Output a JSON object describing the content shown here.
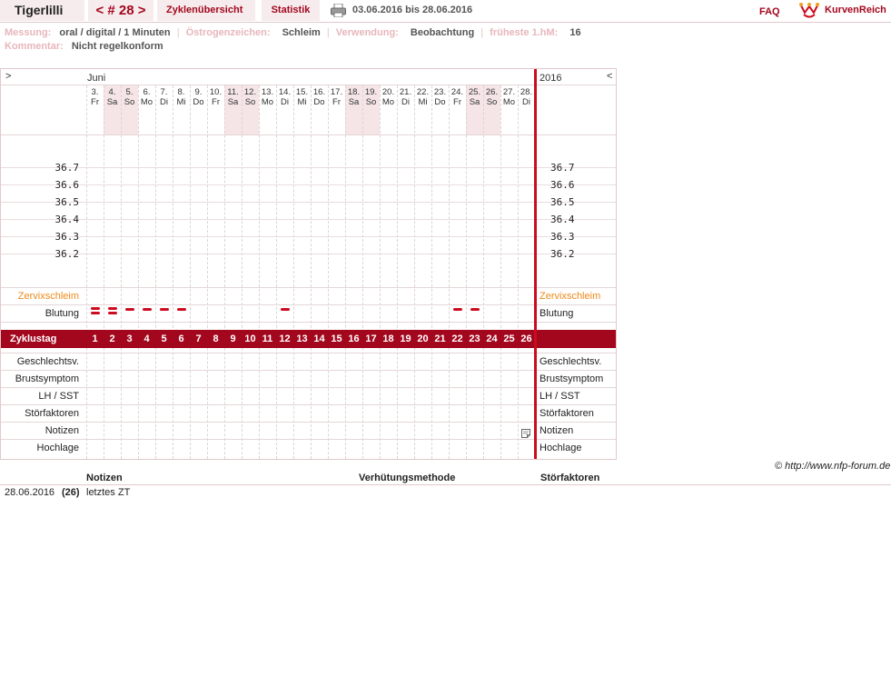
{
  "header": {
    "user_name": "Tigerlilli",
    "cycle_label": "< # 28 >",
    "tab_overview": "Zyklenübersicht",
    "tab_statistics": "Statistik",
    "date_range": "03.06.2016 bis 28.06.2016",
    "faq": "FAQ",
    "logo_text": "KurvenReich"
  },
  "info": {
    "row1": [
      {
        "label": "Messung:",
        "value": "oral / digital / 1 Minuten"
      },
      {
        "label": "Östrogenzeichen:",
        "value": "Schleim"
      },
      {
        "label": "Verwendung:",
        "value": "Beobachtung"
      },
      {
        "label": "früheste 1.hM:",
        "value": "16"
      }
    ],
    "row2": [
      {
        "label": "Kommentar:",
        "value": "Nicht regelkonform"
      }
    ]
  },
  "chart": {
    "nav_prev": ">",
    "nav_next": "<",
    "month": "Juni",
    "year": "2016",
    "days": [
      {
        "d": "3.",
        "w": "Fr",
        "weekend": false
      },
      {
        "d": "4.",
        "w": "Sa",
        "weekend": true
      },
      {
        "d": "5.",
        "w": "So",
        "weekend": true
      },
      {
        "d": "6.",
        "w": "Mo",
        "weekend": false
      },
      {
        "d": "7.",
        "w": "Di",
        "weekend": false
      },
      {
        "d": "8.",
        "w": "Mi",
        "weekend": false
      },
      {
        "d": "9.",
        "w": "Do",
        "weekend": false
      },
      {
        "d": "10.",
        "w": "Fr",
        "weekend": false
      },
      {
        "d": "11.",
        "w": "Sa",
        "weekend": true
      },
      {
        "d": "12.",
        "w": "So",
        "weekend": true
      },
      {
        "d": "13.",
        "w": "Mo",
        "weekend": false
      },
      {
        "d": "14.",
        "w": "Di",
        "weekend": false
      },
      {
        "d": "15.",
        "w": "Mi",
        "weekend": false
      },
      {
        "d": "16.",
        "w": "Do",
        "weekend": false
      },
      {
        "d": "17.",
        "w": "Fr",
        "weekend": false
      },
      {
        "d": "18.",
        "w": "Sa",
        "weekend": true
      },
      {
        "d": "19.",
        "w": "So",
        "weekend": true
      },
      {
        "d": "20.",
        "w": "Mo",
        "weekend": false
      },
      {
        "d": "21.",
        "w": "Di",
        "weekend": false
      },
      {
        "d": "22.",
        "w": "Mi",
        "weekend": false
      },
      {
        "d": "23.",
        "w": "Do",
        "weekend": false
      },
      {
        "d": "24.",
        "w": "Fr",
        "weekend": false
      },
      {
        "d": "25.",
        "w": "Sa",
        "weekend": true
      },
      {
        "d": "26.",
        "w": "So",
        "weekend": true
      },
      {
        "d": "27.",
        "w": "Mo",
        "weekend": false
      },
      {
        "d": "28.",
        "w": "Di",
        "weekend": false
      }
    ],
    "temperature_scale": [
      "36.7",
      "36.6",
      "36.5",
      "36.4",
      "36.3",
      "36.2"
    ],
    "zervix_label": "Zervixschleim",
    "bleeding_label": "Blutung",
    "bleeding": [
      2,
      2,
      1,
      1,
      1,
      1,
      0,
      0,
      0,
      0,
      0,
      1,
      0,
      0,
      0,
      0,
      0,
      0,
      0,
      0,
      0,
      1,
      1,
      0,
      0,
      0
    ],
    "cycle_day_label": "Zyklustag",
    "cycle_days": [
      "1",
      "2",
      "3",
      "4",
      "5",
      "6",
      "7",
      "8",
      "9",
      "10",
      "11",
      "12",
      "13",
      "14",
      "15",
      "16",
      "17",
      "18",
      "19",
      "20",
      "21",
      "22",
      "23",
      "24",
      "25",
      "26"
    ],
    "bottom_rows": [
      "Geschlechtsv.",
      "Brustsymptom",
      "LH / SST",
      "Störfaktoren",
      "Notizen",
      "Hochlage"
    ],
    "note_day_index": 25
  },
  "copyright": "© http://www.nfp-forum.de",
  "table": {
    "headers": {
      "notes": "Notizen",
      "method": "Verhütungsmethode",
      "disturbances": "Störfaktoren"
    },
    "rows": [
      {
        "date": "28.06.2016",
        "cycle_day": "(26)",
        "note": "letztes ZT"
      }
    ]
  },
  "colors": {
    "accent": "#a3071e",
    "bleeding": "#cc0b1f",
    "zervix": "#ef8a1a",
    "weekend": "#f5e5e7"
  }
}
